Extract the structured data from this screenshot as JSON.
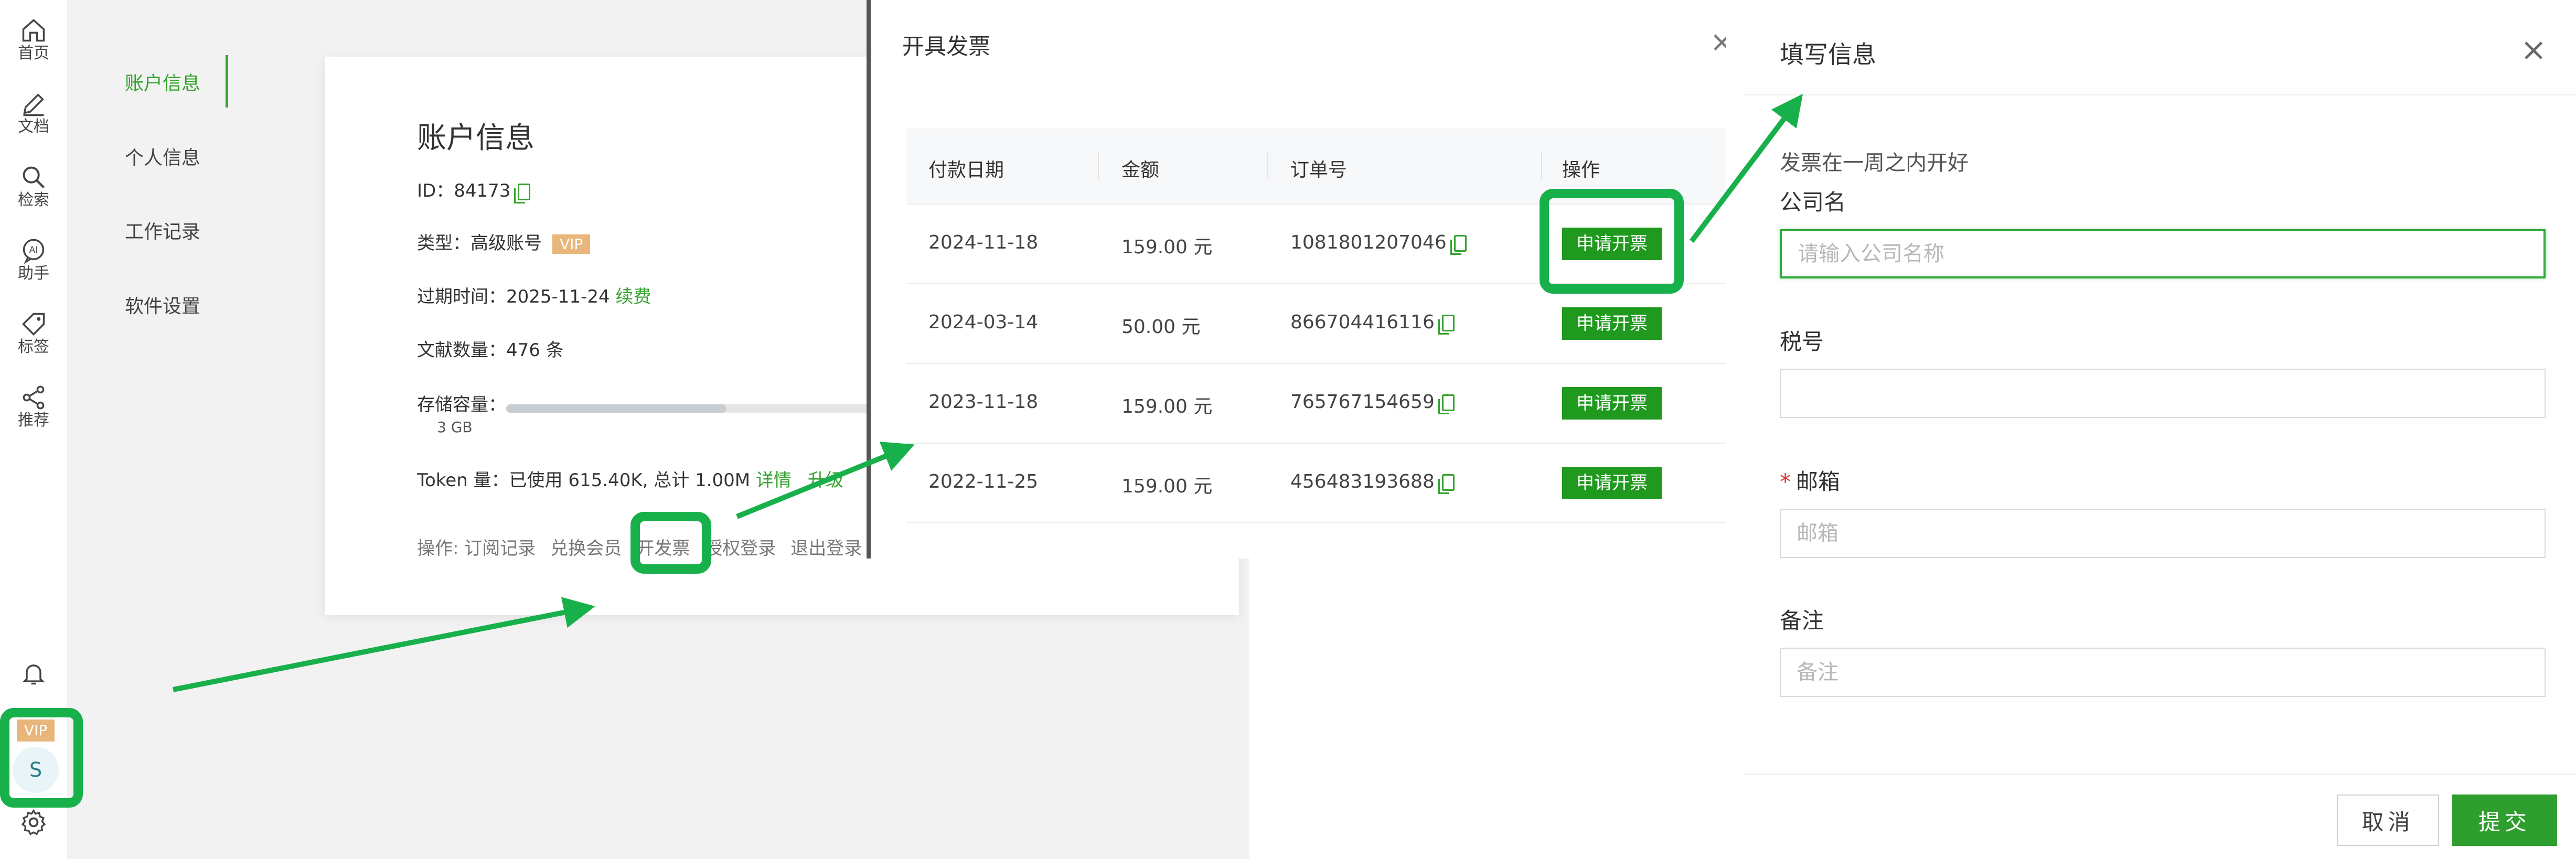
{
  "nav": {
    "items": [
      {
        "label": "首页",
        "icon": "home-icon"
      },
      {
        "label": "文档",
        "icon": "pen-icon"
      },
      {
        "label": "检索",
        "icon": "search-icon"
      },
      {
        "label": "助手",
        "icon": "ai-assistant-icon"
      },
      {
        "label": "标签",
        "icon": "tag-icon"
      },
      {
        "label": "推荐",
        "icon": "share-icon"
      }
    ],
    "bell_icon": "bell-icon",
    "vip_label": "VIP",
    "avatar_letter": "S",
    "settings_icon": "gear-icon"
  },
  "submenu": {
    "items": [
      "账户信息",
      "个人信息",
      "工作记录",
      "软件设置"
    ],
    "active": "账户信息"
  },
  "account": {
    "title": "账户信息",
    "id_label": "ID：",
    "id_value": "84173",
    "type_label": "类型：",
    "type_value": "高级账号",
    "type_badge": "VIP",
    "expire_label": "过期时间：",
    "expire_value": "2025-11-24",
    "renew_link": "续费",
    "docs_label": "文献数量：",
    "docs_value": "476 条",
    "storage_label": "存储容量：",
    "storage_value": "3 GB",
    "storage_used_fraction": 0.28,
    "token_label": "Token 量：",
    "token_value": "已使用 615.40K, 总计 1.00M",
    "token_details": "详情",
    "token_upgrade": "升级",
    "ops_label": "操作:",
    "ops": [
      "订阅记录",
      "兑换会员",
      "开发票",
      "授权登录",
      "退出登录"
    ]
  },
  "invoice_dialog": {
    "title": "开具发票",
    "close": "×",
    "columns": [
      "付款日期",
      "金额",
      "订单号",
      "操作"
    ],
    "rows": [
      {
        "date": "2024-11-18",
        "amount": "159.00 元",
        "order": "1081801207046",
        "action": "申请开票"
      },
      {
        "date": "2024-03-14",
        "amount": "50.00 元",
        "order": "866704416116",
        "action": "申请开票"
      },
      {
        "date": "2023-11-18",
        "amount": "159.00 元",
        "order": "765767154659",
        "action": "申请开票"
      },
      {
        "date": "2022-11-25",
        "amount": "159.00 元",
        "order": "456483193688",
        "action": "申请开票"
      }
    ]
  },
  "fill_info": {
    "title": "填写信息",
    "close": "×",
    "note": "发票在一周之内开好",
    "company_label": "公司名",
    "company_placeholder": "请输入公司名称",
    "tax_label": "税号",
    "tax_placeholder": "",
    "email_required": "*",
    "email_label": "邮箱",
    "email_placeholder": "邮箱",
    "remark_label": "备注",
    "remark_placeholder": "备注",
    "cancel": "取消",
    "submit": "提交"
  },
  "colors": {
    "accent": "#35a32e",
    "annotation": "#18b04a",
    "vip": "#e8b67a",
    "button": "#1f9a1f"
  }
}
